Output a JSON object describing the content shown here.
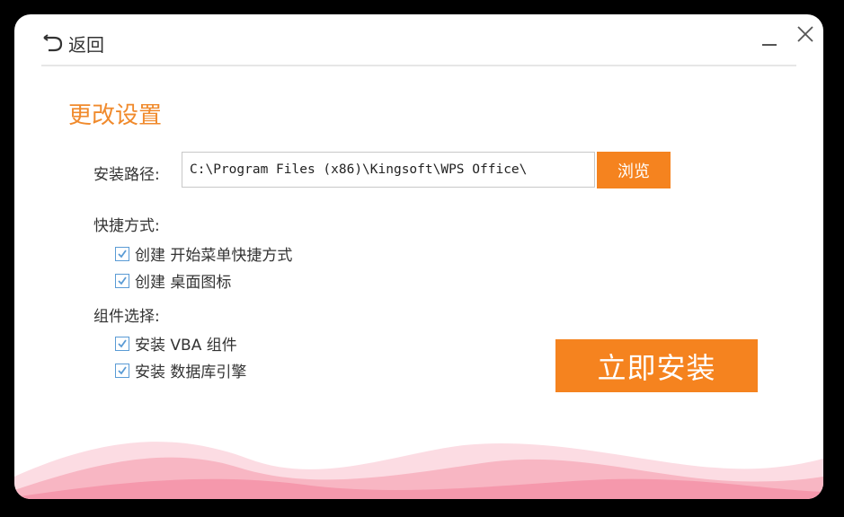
{
  "header": {
    "back_label": "返回"
  },
  "main": {
    "section_title": "更改设置",
    "install_path_label": "安装路径:",
    "install_path_value": "C:\\Program Files (x86)\\Kingsoft\\WPS Office\\",
    "browse_label": "浏览",
    "shortcut_label": "快捷方式:",
    "shortcuts": [
      {
        "label": "创建 开始菜单快捷方式",
        "checked": true
      },
      {
        "label": "创建 桌面图标",
        "checked": true
      }
    ],
    "components_label": "组件选择:",
    "components": [
      {
        "label": "安装 VBA 组件",
        "checked": true
      },
      {
        "label": "安装 数据库引擎",
        "checked": true
      }
    ],
    "install_button": "立即安装"
  },
  "colors": {
    "accent": "#f5831f",
    "title": "#f08a2c",
    "checkbox": "#5a9bd5",
    "wave": "#f7a9b8"
  }
}
